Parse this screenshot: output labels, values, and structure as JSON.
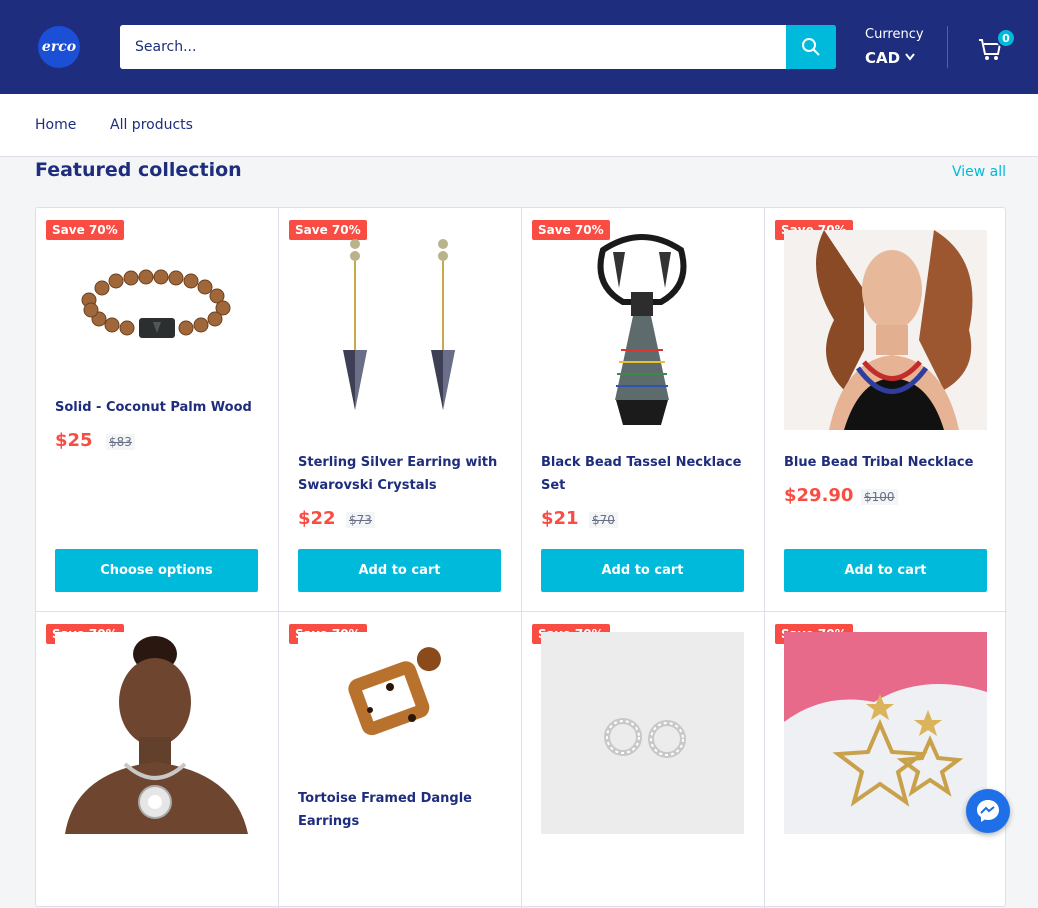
{
  "header": {
    "logo_text": "erco",
    "search_placeholder": "Search...",
    "currency_label": "Currency",
    "currency_value": "CAD",
    "cart_count": "0"
  },
  "nav": {
    "items": [
      "Home",
      "All products"
    ]
  },
  "section": {
    "title": "Featured collection",
    "view_all": "View all"
  },
  "products": [
    {
      "badge": "Save 70%",
      "name": "Solid - Coconut Palm Wood",
      "price": "$25",
      "compare": "$83",
      "button": "Choose options",
      "image": "bracelet"
    },
    {
      "badge": "Save 70%",
      "name": "Sterling Silver Earring with Swarovski Crystals",
      "price": "$22",
      "compare": "$73",
      "button": "Add to cart",
      "image": "earrings-crystal"
    },
    {
      "badge": "Save 70%",
      "name": "Black Bead Tassel Necklace Set",
      "price": "$21",
      "compare": "$70",
      "button": "Add to cart",
      "image": "necklace-tassel"
    },
    {
      "badge": "Save 70%",
      "name": "Blue Bead Tribal Necklace",
      "price": "$29.90",
      "compare": "$100",
      "button": "Add to cart",
      "image": "model-necklace"
    },
    {
      "badge": "Save 70%",
      "name": "",
      "image": "model-pendant"
    },
    {
      "badge": "Save 70%",
      "name": "Tortoise Framed Dangle Earrings",
      "image": "tortoise-earrings"
    },
    {
      "badge": "Save 70%",
      "name": "",
      "image": "circle-studs"
    },
    {
      "badge": "Save 70%",
      "name": "",
      "image": "star-earrings"
    }
  ],
  "colors": {
    "header_bg": "#1e2d7d",
    "accent": "#00badb",
    "sale": "#f94c43"
  }
}
